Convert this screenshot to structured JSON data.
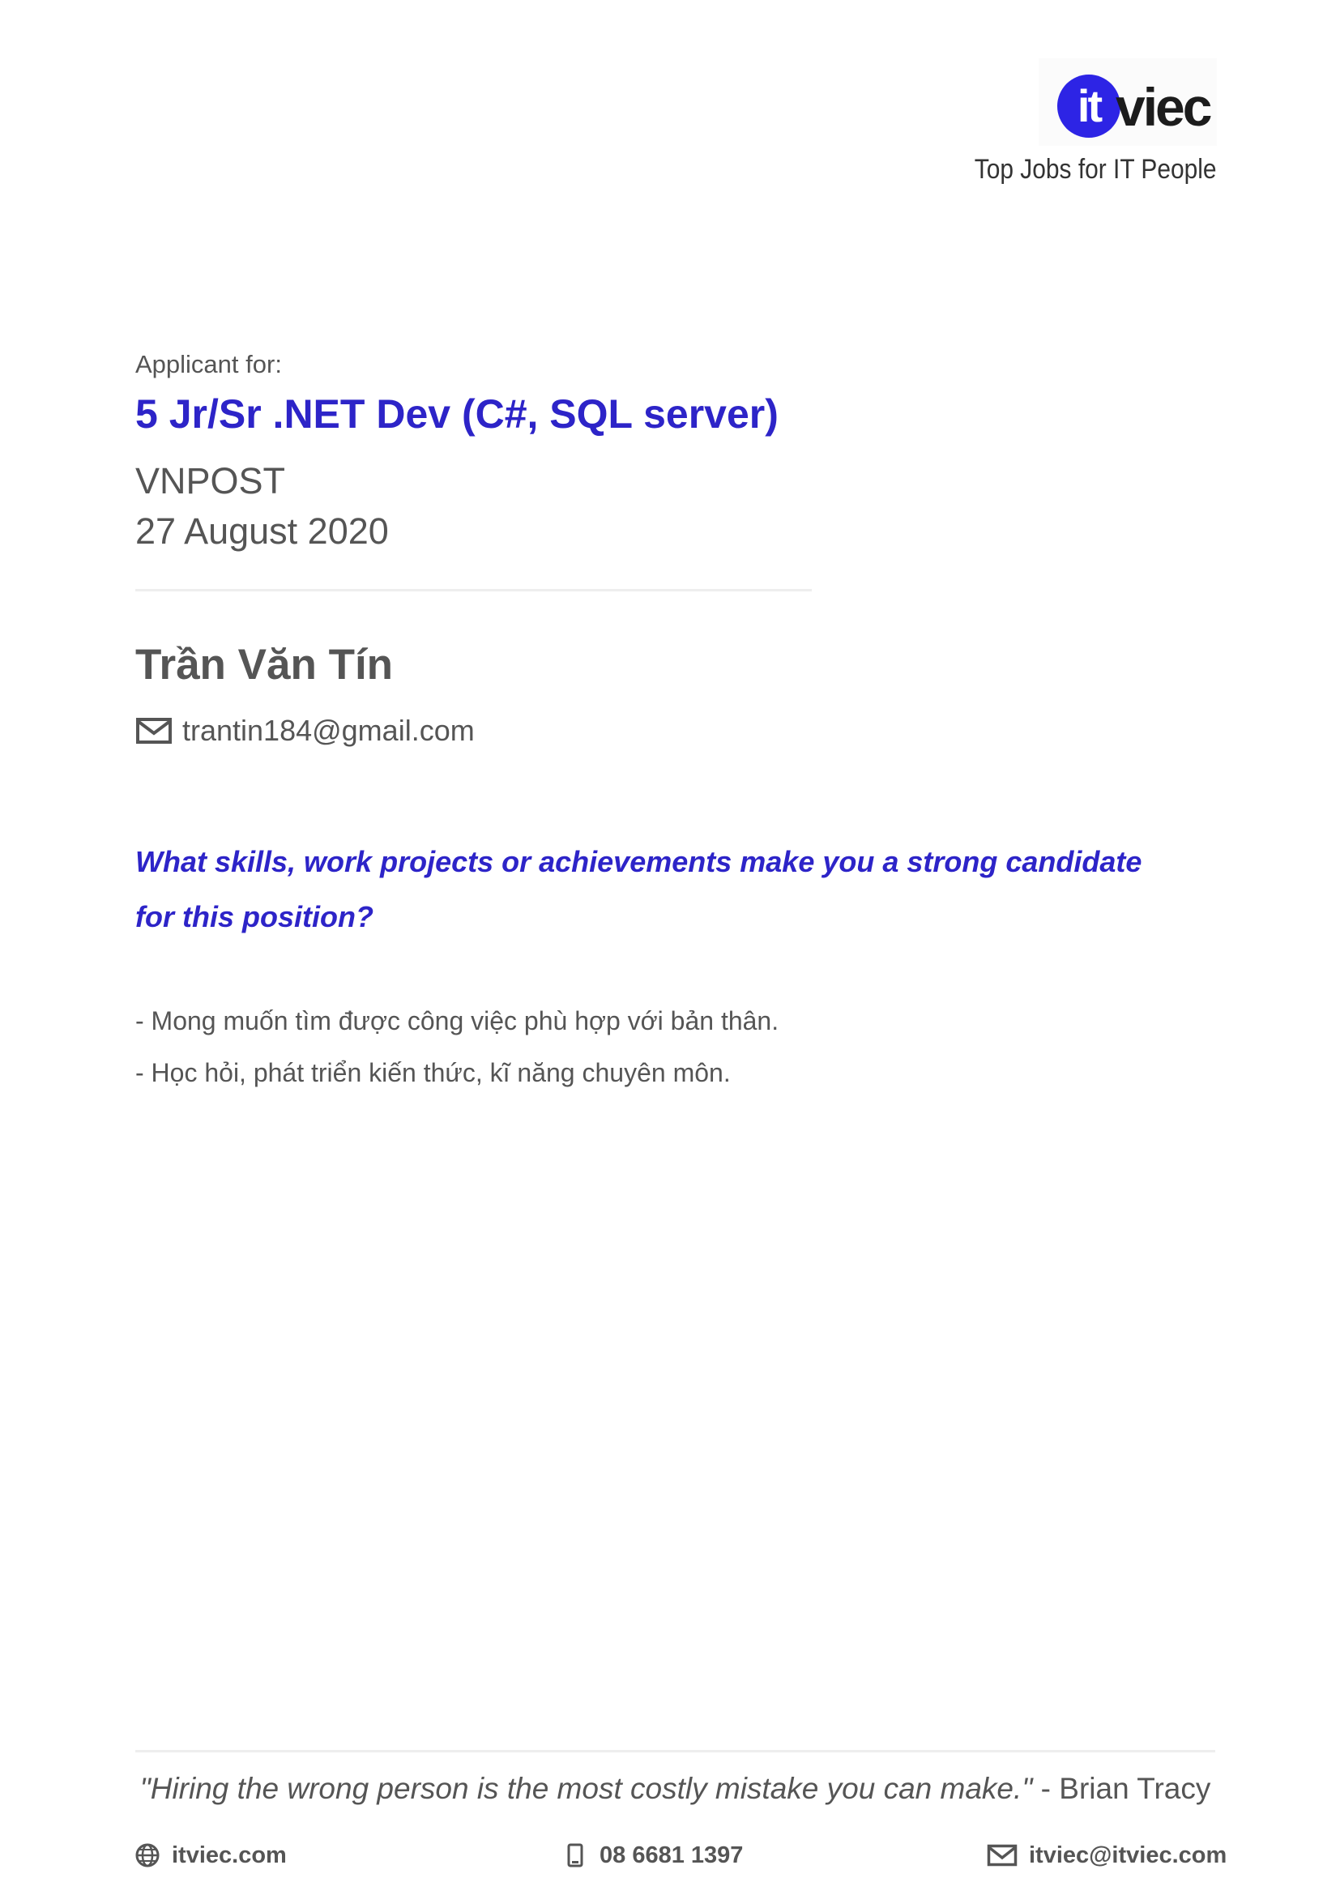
{
  "header": {
    "logo_mark_text": "it",
    "logo_rest_text": "viec",
    "tagline": "Top Jobs for IT People"
  },
  "application": {
    "label": "Applicant for:",
    "job_title": "5 Jr/Sr .NET Dev (C#, SQL server)",
    "company": "VNPOST",
    "date": "27 August 2020"
  },
  "candidate": {
    "name": "Trần Văn Tín",
    "email": "trantin184@gmail.com"
  },
  "question": {
    "text": "What skills, work projects or achievements make you a strong candidate for this position?",
    "answer_lines": [
      "- Mong muốn tìm được công việc phù hợp với bản thân.",
      "- Học hỏi, phát triển kiến thức, kĩ năng chuyên môn."
    ]
  },
  "footer": {
    "quote": "\"Hiring the wrong person is the most costly mistake you can make.\"",
    "quote_author": " - Brian Tracy",
    "website": "itviec.com",
    "phone": "08 6681 1397",
    "email": "itviec@itviec.com"
  },
  "colors": {
    "accent": "#2d24c8",
    "logo_circle": "#2d24e5",
    "text": "#555555"
  },
  "icons": {
    "email": "envelope-icon",
    "website": "globe-icon",
    "phone": "mobile-phone-icon"
  }
}
